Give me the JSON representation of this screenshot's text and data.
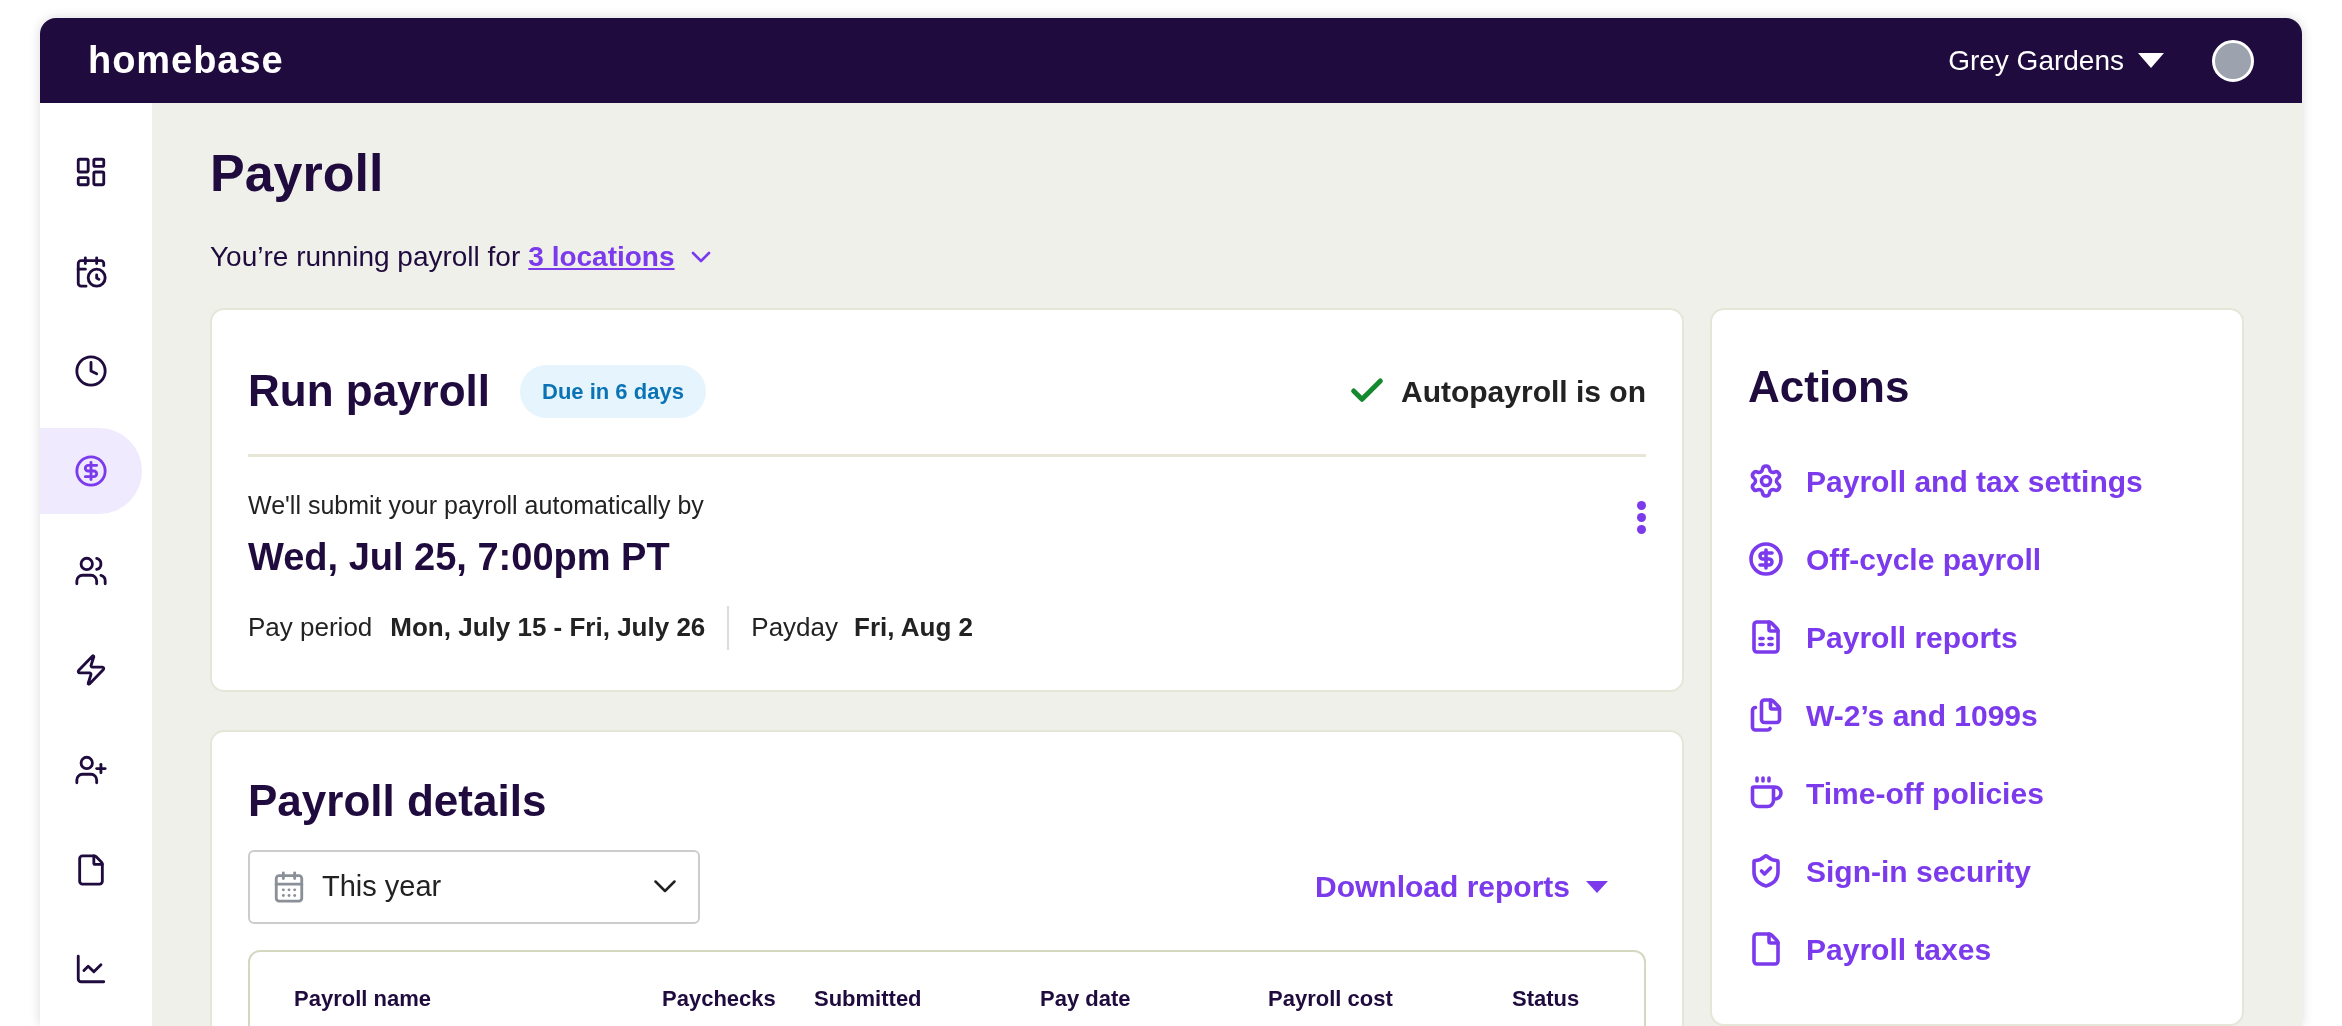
{
  "header": {
    "logo": "homebase",
    "location": "Grey Gardens"
  },
  "sidebar": {
    "items": [
      {
        "selected": false
      },
      {
        "selected": false
      },
      {
        "selected": false
      },
      {
        "selected": true
      },
      {
        "selected": false
      },
      {
        "selected": false
      },
      {
        "selected": false
      },
      {
        "selected": false
      },
      {
        "selected": false
      }
    ]
  },
  "page": {
    "title": "Payroll",
    "subtitle": "You’re running payroll for",
    "locations_link": "3 locations"
  },
  "run_payroll": {
    "title": "Run payroll",
    "badge": "Due in 6 days",
    "autopayroll": "Autopayroll is on",
    "submit_note": "We'll submit your payroll automatically by",
    "deadline": "Wed, Jul 25, 7:00pm PT",
    "pay_period_label": "Pay period",
    "pay_period": "Mon, July 15 - Fri, July 26",
    "payday_label": "Payday",
    "payday": "Fri, Aug 2"
  },
  "payroll_details": {
    "title": "Payroll details",
    "range_select": "This year",
    "download": "Download reports",
    "table": {
      "columns": [
        "Payroll name",
        "Paychecks",
        "Submitted",
        "Pay date",
        "Payroll cost",
        "Status"
      ]
    }
  },
  "actions": {
    "title": "Actions",
    "items": [
      {
        "label": "Payroll and tax settings"
      },
      {
        "label": "Off-cycle payroll"
      },
      {
        "label": "Payroll reports"
      },
      {
        "label": "W-2’s and 1099s"
      },
      {
        "label": "Time-off policies"
      },
      {
        "label": "Sign-in security"
      },
      {
        "label": "Payroll taxes"
      }
    ]
  }
}
